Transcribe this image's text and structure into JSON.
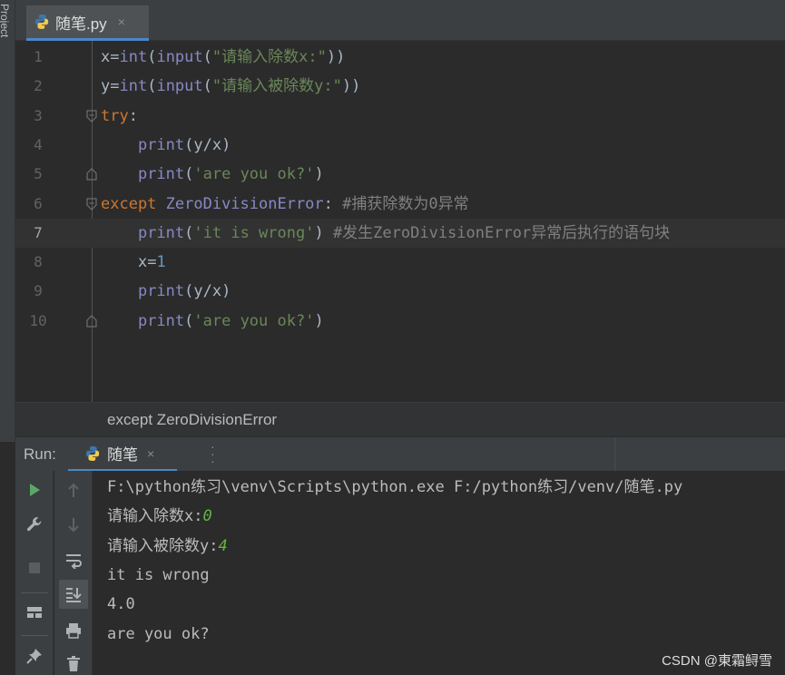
{
  "project_tool": {
    "label": "Project"
  },
  "editor_tabs": [
    {
      "title": "随笔.py",
      "icon": "python-file-icon",
      "close": "×"
    }
  ],
  "editor": {
    "current_line": 7,
    "lines": [
      {
        "num": "1",
        "indent": "",
        "tokens": [
          {
            "t": "x=",
            "c": "op"
          },
          {
            "t": "int",
            "c": "fn"
          },
          {
            "t": "(",
            "c": "op"
          },
          {
            "t": "input",
            "c": "fn"
          },
          {
            "t": "(",
            "c": "op"
          },
          {
            "t": "\"请输入除数x:\"",
            "c": "str"
          },
          {
            "t": "))",
            "c": "op"
          }
        ]
      },
      {
        "num": "2",
        "indent": "",
        "tokens": [
          {
            "t": "y=",
            "c": "op"
          },
          {
            "t": "int",
            "c": "fn"
          },
          {
            "t": "(",
            "c": "op"
          },
          {
            "t": "input",
            "c": "fn"
          },
          {
            "t": "(",
            "c": "op"
          },
          {
            "t": "\"请输入被除数y:\"",
            "c": "str"
          },
          {
            "t": "))",
            "c": "op"
          }
        ]
      },
      {
        "num": "3",
        "indent": "",
        "fold": "open",
        "tokens": [
          {
            "t": "try",
            "c": "kw"
          },
          {
            "t": ":",
            "c": "op"
          }
        ]
      },
      {
        "num": "4",
        "indent": "    ",
        "tokens": [
          {
            "t": "print",
            "c": "fn"
          },
          {
            "t": "(y/x)",
            "c": "op"
          }
        ]
      },
      {
        "num": "5",
        "indent": "    ",
        "fold": "end",
        "tokens": [
          {
            "t": "print",
            "c": "fn"
          },
          {
            "t": "(",
            "c": "op"
          },
          {
            "t": "'are you ok?'",
            "c": "str"
          },
          {
            "t": ")",
            "c": "op"
          }
        ]
      },
      {
        "num": "6",
        "indent": "",
        "fold": "open",
        "tokens": [
          {
            "t": "except ",
            "c": "kw"
          },
          {
            "t": "ZeroDivisionError",
            "c": "fn"
          },
          {
            "t": ": ",
            "c": "op"
          },
          {
            "t": "#捕获除数为0异常",
            "c": "cm"
          }
        ]
      },
      {
        "num": "7",
        "indent": "    ",
        "tokens": [
          {
            "t": "print",
            "c": "fn"
          },
          {
            "t": "(",
            "c": "op"
          },
          {
            "t": "'it is wrong'",
            "c": "str"
          },
          {
            "t": ") ",
            "c": "op"
          },
          {
            "t": "#发生ZeroDivisionError异常后执行的语句块",
            "c": "cm"
          }
        ]
      },
      {
        "num": "8",
        "indent": "    ",
        "tokens": [
          {
            "t": "x=",
            "c": "op"
          },
          {
            "t": "1",
            "c": "num"
          }
        ]
      },
      {
        "num": "9",
        "indent": "    ",
        "tokens": [
          {
            "t": "print",
            "c": "fn"
          },
          {
            "t": "(y/x)",
            "c": "op"
          }
        ]
      },
      {
        "num": "10",
        "indent": "    ",
        "fold": "end",
        "tokens": [
          {
            "t": "print",
            "c": "fn"
          },
          {
            "t": "(",
            "c": "op"
          },
          {
            "t": "'are you ok?'",
            "c": "str"
          },
          {
            "t": ")",
            "c": "op"
          }
        ]
      }
    ]
  },
  "breadcrumb": {
    "text": "except ZeroDivisionError"
  },
  "run_panel": {
    "label": "Run:",
    "tab_title": "随笔",
    "tab_icon": "python-icon",
    "close": "×",
    "toolbar_left": [
      "run-icon",
      "wrench-icon",
      "stop-icon",
      "layout-icon",
      "pin-icon"
    ],
    "toolbar_right": [
      "up-arrow-icon",
      "down-arrow-icon",
      "soft-wrap-icon",
      "scroll-to-end-icon",
      "print-icon",
      "trash-icon"
    ],
    "console": [
      {
        "text": "F:\\python练习\\venv\\Scripts\\python.exe F:/python练习/venv/随笔.py",
        "input": ""
      },
      {
        "text": "请输入除数x:",
        "input": "0"
      },
      {
        "text": "请输入被除数y:",
        "input": "4"
      },
      {
        "text": "it is wrong",
        "input": ""
      },
      {
        "text": "4.0",
        "input": ""
      },
      {
        "text": "are you ok?",
        "input": ""
      }
    ]
  },
  "watermark": "CSDN @東霜鲟雪",
  "colors": {
    "keyword": "#cc7832",
    "builtin": "#8888c6",
    "string": "#6a8759",
    "number": "#6897bb",
    "comment": "#808080",
    "console_input": "#62b543",
    "accent": "#4a88c7"
  }
}
